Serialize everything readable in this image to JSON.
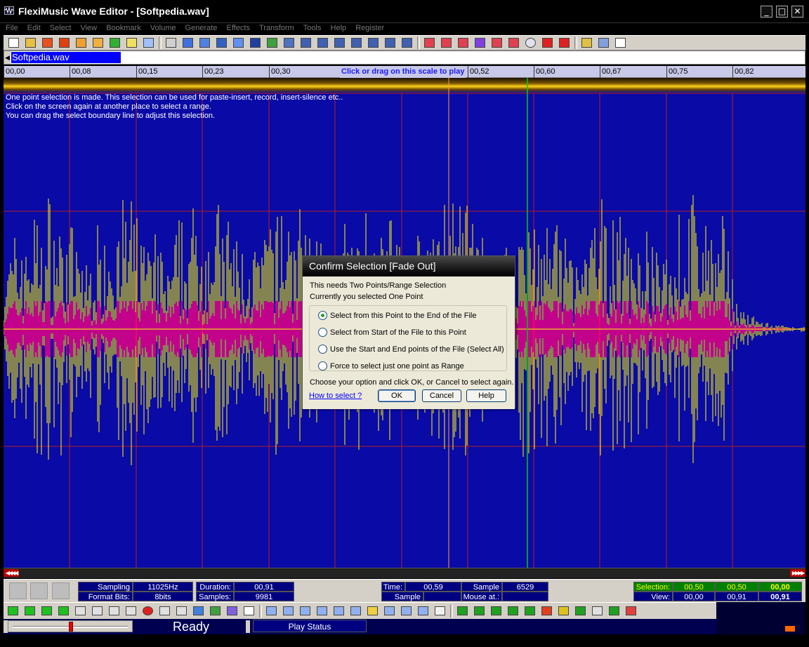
{
  "window": {
    "title": "FlexiMusic Wave Editor - [Softpedia.wav]"
  },
  "menu": [
    "File",
    "Edit",
    "Select",
    "View",
    "Bookmark",
    "Volume",
    "Generate",
    "Effects",
    "Transform",
    "Tools",
    "Help",
    "Register"
  ],
  "tab": {
    "label": "Softpedia.wav"
  },
  "ruler": {
    "ticks": [
      "00,00",
      "00,08",
      "00,15",
      "00,23",
      "00,30",
      "00,52",
      "00,60",
      "00,67",
      "00,75",
      "00,82"
    ],
    "hint": "Click or drag on this scale to play"
  },
  "info_lines": [
    "One point selection is made. This selection can be used for paste-insert, record, insert-silence etc..",
    "Click on the screen again at another place to select a range.",
    "You can drag the select boundary line to adjust this selection."
  ],
  "dialog": {
    "title": "Confirm Selection [Fade Out]",
    "line1": "This needs Two Points/Range Selection",
    "line2": "Currently you selected One Point",
    "options": [
      "Select from this Point to the End of the File",
      "Select from Start of the File to this Point",
      "Use the Start and End points of the File (Select All)",
      "Force to select just one point as Range"
    ],
    "selected_option": 0,
    "instruction": "Choose your option and click OK, or Cancel to select again.",
    "help_link": "How to select ?",
    "ok": "OK",
    "cancel": "Cancel",
    "help": "Help"
  },
  "status": {
    "sampling_rate_label": "Sampling Rate:",
    "sampling_rate": "11025Hz",
    "format_bits_label": "Format Bits:",
    "format_bits": "8bits",
    "duration_label": "Duration:",
    "duration": "00,91",
    "samples_label": "Samples:",
    "samples": "9981",
    "time_label": "Time:",
    "time": "00,59",
    "sample_ht_label": "Sample ht.:",
    "sample_ht": "",
    "sample_no_label": "Sample no.",
    "sample_no": "6529",
    "mouse_at_label": "Mouse at.:",
    "mouse_at": "",
    "selection_label": "Selection:",
    "selection": [
      "00,50",
      "00,50",
      "00,00"
    ],
    "view_label": "View:",
    "view": [
      "00,00",
      "00,91",
      "00,91"
    ]
  },
  "footer": {
    "ready": "Ready",
    "play_status": "Play Status"
  },
  "colors": {
    "wave_bg": "#0a0aa6",
    "wave_peak": "#ffff00",
    "wave_rms": "#ff0080",
    "grid": "#b02020",
    "cursor_green": "#00d000",
    "cursor_orange": "#ffa040"
  }
}
